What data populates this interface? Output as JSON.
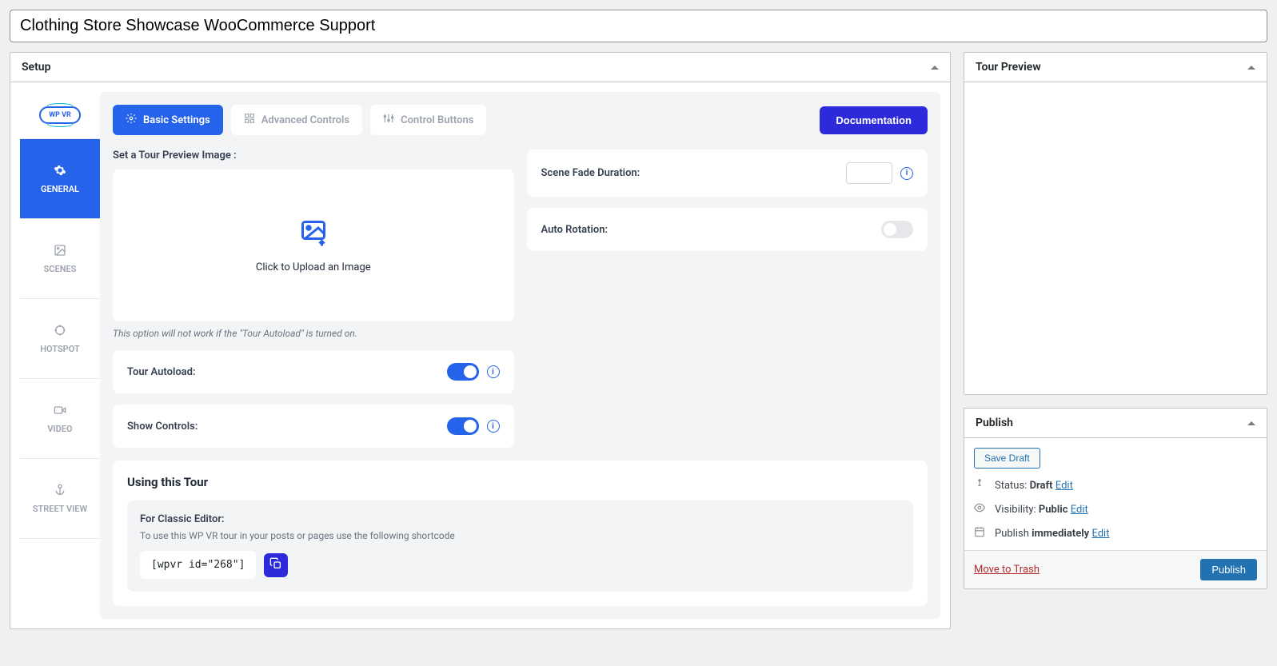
{
  "title": "Clothing Store Showcase WooCommerce Support",
  "setup": {
    "header": "Setup",
    "logo_text": "WP VR",
    "side_tabs": {
      "general": "GENERAL",
      "scenes": "SCENES",
      "hotspot": "HOTSPOT",
      "video": "VIDEO",
      "street_view": "STREET VIEW"
    },
    "top_tabs": {
      "basic": "Basic Settings",
      "advanced": "Advanced Controls",
      "control_buttons": "Control Buttons"
    },
    "documentation_btn": "Documentation",
    "preview_label": "Set a Tour Preview Image :",
    "upload_text": "Click to Upload an Image",
    "preview_hint": "This option will not work if the \"Tour Autoload\" is turned on.",
    "tour_autoload_label": "Tour Autoload:",
    "show_controls_label": "Show Controls:",
    "scene_fade_label": "Scene Fade Duration:",
    "auto_rotation_label": "Auto Rotation:",
    "using_tour_title": "Using this Tour",
    "classic_editor_title": "For Classic Editor:",
    "classic_editor_hint": "To use this WP VR tour in your posts or pages use the following shortcode",
    "shortcode": "[wpvr id=\"268\"]"
  },
  "tour_preview": {
    "header": "Tour Preview"
  },
  "publish": {
    "header": "Publish",
    "save_draft": "Save Draft",
    "status_label": "Status:",
    "status_value": "Draft",
    "visibility_label": "Visibility:",
    "visibility_value": "Public",
    "publish_label": "Publish",
    "publish_value": "immediately",
    "edit": "Edit",
    "trash": "Move to Trash",
    "publish_btn": "Publish"
  }
}
